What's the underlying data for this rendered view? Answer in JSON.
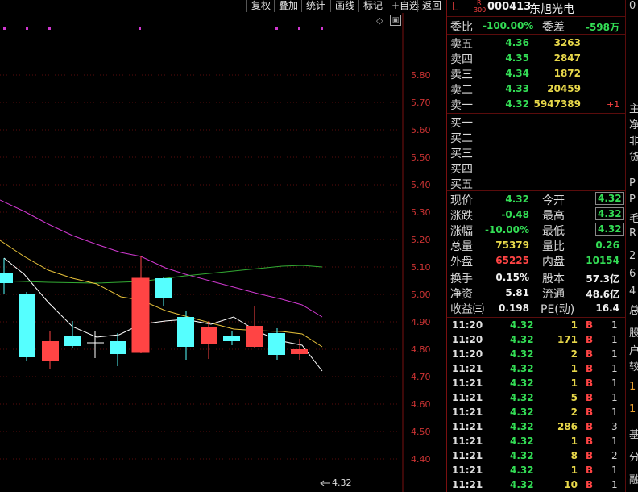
{
  "toolbar": {
    "buttons": [
      "复权",
      "叠加",
      "统计",
      "画线",
      "标记",
      "+自选",
      "返回"
    ]
  },
  "chart": {
    "y_labels": [
      "5.80",
      "5.70",
      "5.60",
      "5.50",
      "5.40",
      "5.30",
      "5.20",
      "5.10",
      "5.00",
      "4.90",
      "4.80",
      "4.70",
      "4.60",
      "4.50",
      "4.40"
    ],
    "last_price_marker": "4.32"
  },
  "quote": {
    "market_tag": "L",
    "board_tag_top": "R",
    "board_tag_bottom": "300",
    "code": "000413",
    "name": "东旭光电",
    "weibi_label": "委比",
    "weibi_value": "-100.00%",
    "weicha_label": "委差",
    "weicha_value": "-598万",
    "asks": [
      {
        "label": "卖五",
        "price": "4.36",
        "vol": "3263",
        "chg": ""
      },
      {
        "label": "卖四",
        "price": "4.35",
        "vol": "2847",
        "chg": ""
      },
      {
        "label": "卖三",
        "price": "4.34",
        "vol": "1872",
        "chg": ""
      },
      {
        "label": "卖二",
        "price": "4.33",
        "vol": "20459",
        "chg": ""
      },
      {
        "label": "卖一",
        "price": "4.32",
        "vol": "5947389",
        "chg": "+1"
      }
    ],
    "bids": [
      {
        "label": "买一"
      },
      {
        "label": "买二"
      },
      {
        "label": "买三"
      },
      {
        "label": "买四"
      },
      {
        "label": "买五"
      }
    ],
    "stats": {
      "xianjia_label": "现价",
      "xianjia": "4.32",
      "jinkai_label": "今开",
      "jinkai": "4.32",
      "zhangdie_label": "涨跌",
      "zhangdie": "-0.48",
      "zuigao_label": "最高",
      "zuigao": "4.32",
      "zhangfu_label": "涨幅",
      "zhangfu": "-10.00%",
      "zuidi_label": "最低",
      "zuidi": "4.32",
      "zongliang_label": "总量",
      "zongliang": "75379",
      "liangbi_label": "量比",
      "liangbi": "0.26",
      "waipan_label": "外盘",
      "waipan": "65225",
      "neipan_label": "内盘",
      "neipan": "10154",
      "huanshou_label": "换手",
      "huanshou": "0.15%",
      "guben_label": "股本",
      "guben": "57.3亿",
      "jingzi_label": "净资",
      "jingzi": "5.81",
      "liutong_label": "流通",
      "liutong": "48.6亿",
      "shouyi_label": "收益㈢",
      "shouyi": "0.198",
      "pe_label": "PE(动)",
      "pe": "16.4"
    },
    "ticks": [
      {
        "time": "11:20",
        "price": "4.32",
        "vol": "1",
        "side": "B",
        "count": "1"
      },
      {
        "time": "11:20",
        "price": "4.32",
        "vol": "171",
        "side": "B",
        "count": "1"
      },
      {
        "time": "11:20",
        "price": "4.32",
        "vol": "2",
        "side": "B",
        "count": "1"
      },
      {
        "time": "11:21",
        "price": "4.32",
        "vol": "1",
        "side": "B",
        "count": "1"
      },
      {
        "time": "11:21",
        "price": "4.32",
        "vol": "1",
        "side": "B",
        "count": "1"
      },
      {
        "time": "11:21",
        "price": "4.32",
        "vol": "5",
        "side": "B",
        "count": "1"
      },
      {
        "time": "11:21",
        "price": "4.32",
        "vol": "2",
        "side": "B",
        "count": "1"
      },
      {
        "time": "11:21",
        "price": "4.32",
        "vol": "286",
        "side": "B",
        "count": "3"
      },
      {
        "time": "11:21",
        "price": "4.32",
        "vol": "1",
        "side": "B",
        "count": "1"
      },
      {
        "time": "11:21",
        "price": "4.32",
        "vol": "8",
        "side": "B",
        "count": "2"
      },
      {
        "time": "11:21",
        "price": "4.32",
        "vol": "1",
        "side": "B",
        "count": "1"
      },
      {
        "time": "11:21",
        "price": "4.32",
        "vol": "10",
        "side": "B",
        "count": "1"
      }
    ]
  },
  "far_right": {
    "items": [
      "0",
      "主",
      "净",
      "非",
      "货",
      "P",
      "P",
      "毛",
      "R",
      "2",
      "6",
      "4",
      "总",
      "股",
      "户",
      "较",
      "1",
      "1",
      "基",
      "分",
      "融"
    ]
  },
  "colors": {
    "up": "#ff4444",
    "down": "#55ffff",
    "ma5": "#ffffff",
    "ma10": "#e8c23a",
    "ma20": "#d038d0",
    "ma60": "#33aa33"
  }
}
